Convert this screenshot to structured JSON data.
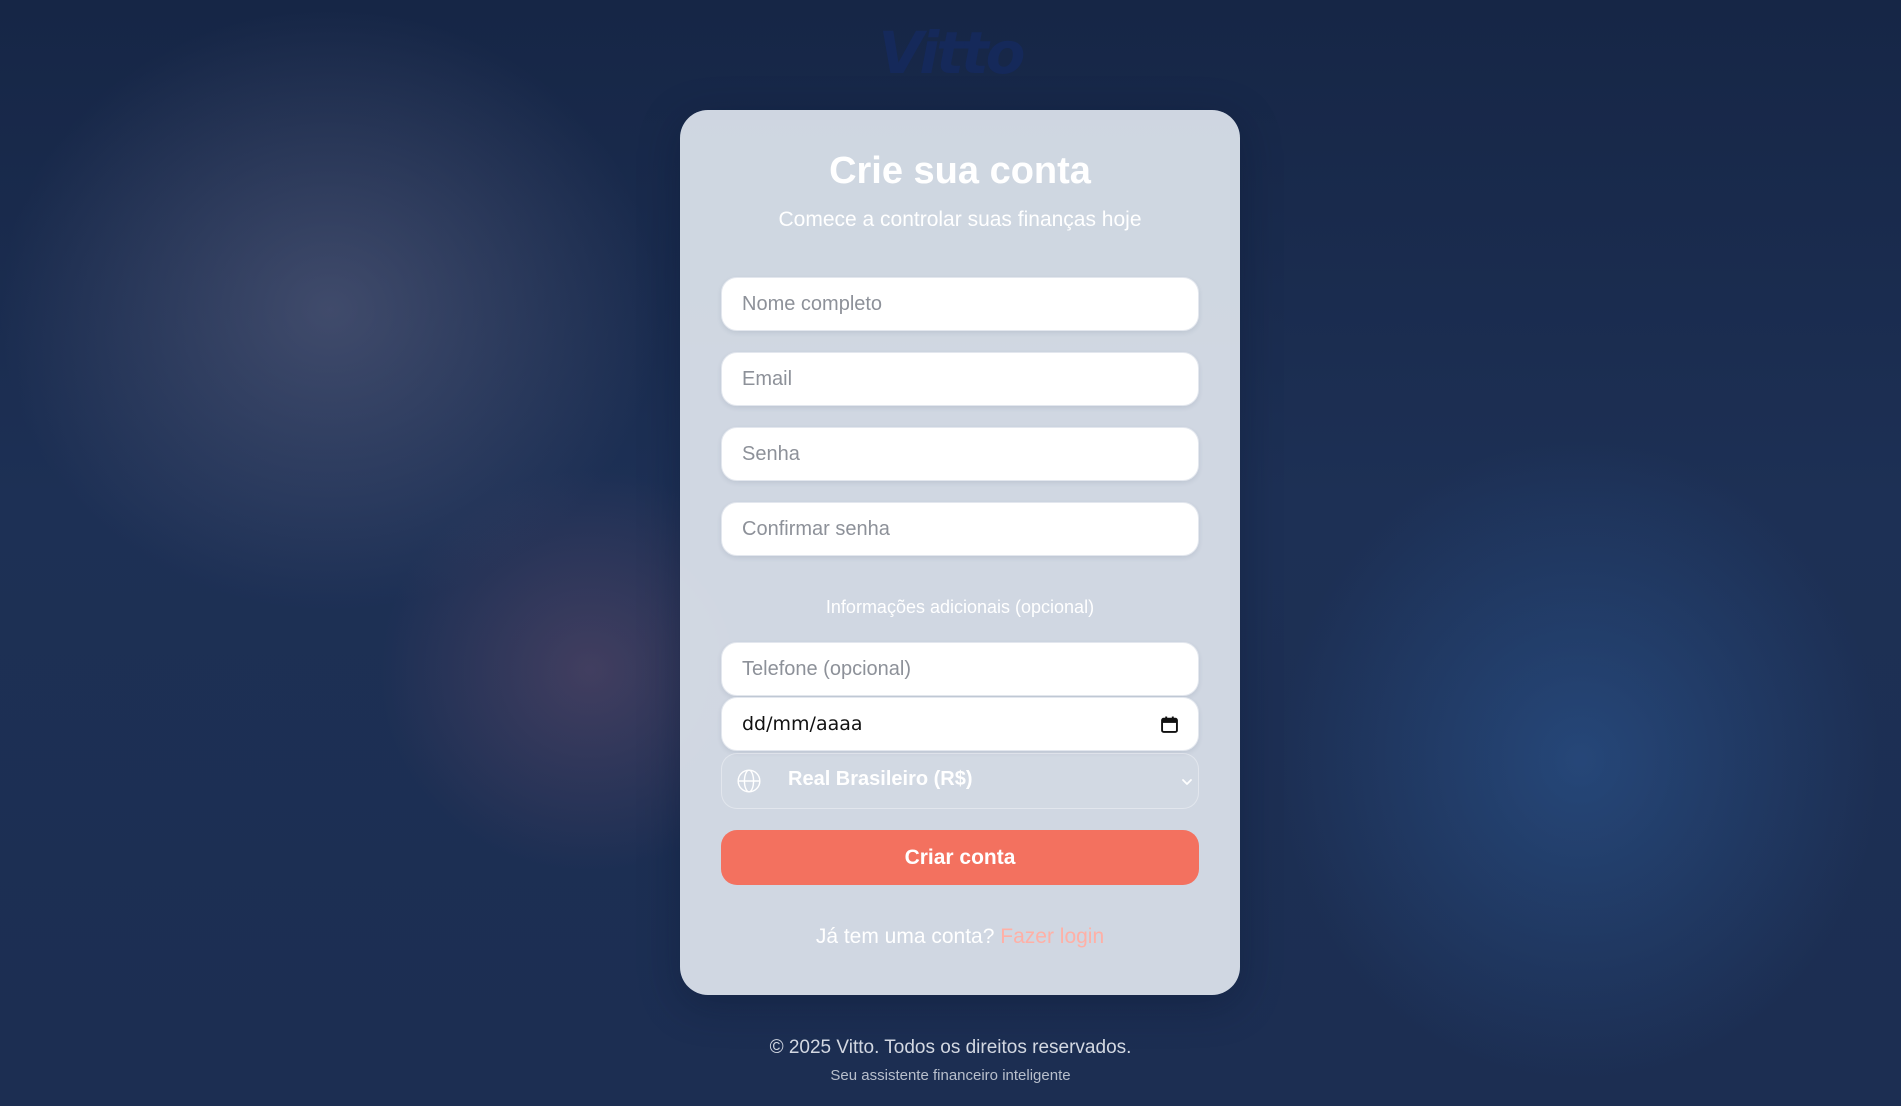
{
  "brand": {
    "logo_text": "Vitto"
  },
  "signup": {
    "title": "Crie sua conta",
    "subtitle": "Comece a controlar suas finanças hoje",
    "name_placeholder": "Nome completo",
    "email_placeholder": "Email",
    "password_placeholder": "Senha",
    "confirm_password_placeholder": "Confirmar senha",
    "optional_section_label": "Informações adicionais (opcional)",
    "phone_placeholder": "Telefone (opcional)",
    "birthdate_value": "dd/mm/aaaa",
    "currency_selected": "Real Brasileiro (R$)",
    "submit_label": "Criar conta",
    "login_prompt": "Já tem uma conta?",
    "login_link_label": "Fazer login"
  },
  "footer": {
    "copyright": "© 2025 Vitto. Todos os direitos reservados.",
    "tagline": "Seu assistente financeiro inteligente"
  },
  "icons": {
    "currency": "globe-icon",
    "date": "calendar-icon",
    "select": "chevron-down-icon"
  },
  "colors": {
    "accent": "#f3715f",
    "link": "#ffb0a6",
    "background": "#1b2b4d",
    "logo": "#15295a"
  }
}
